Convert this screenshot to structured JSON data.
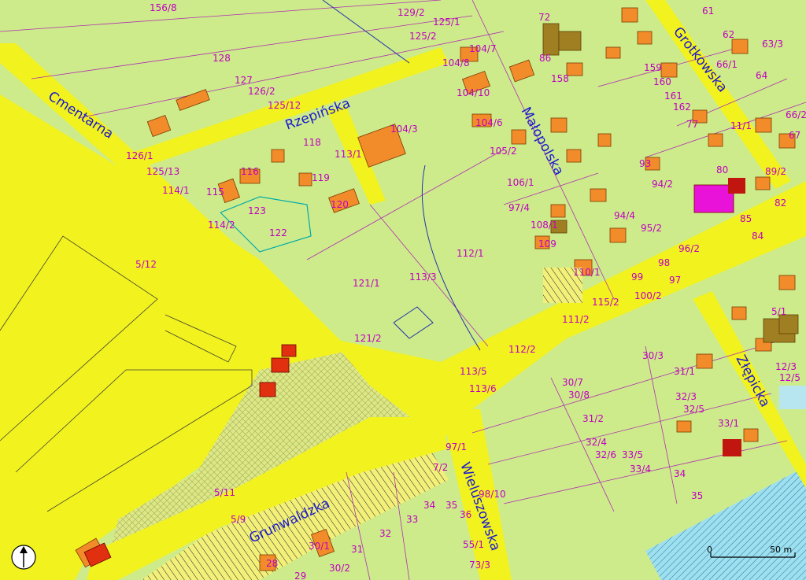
{
  "streets": {
    "cmentarna": "Cmentarna",
    "rzepinska": "Rzepińska",
    "grotkowska": "Grotkowska",
    "malopolska": "Małopolska",
    "zlepicka": "Złępicka",
    "grunwaldzka": "Grunwaldzka",
    "wieluszowska": "Wieluszowska"
  },
  "parcels": {
    "p156_8": "156/8",
    "p129_2": "129/2",
    "p125_1": "125/1",
    "p125_2": "125/2",
    "p128": "128",
    "p127": "127",
    "p126_2": "126/2",
    "p125_12": "125/12",
    "p126_1": "126/1",
    "p125_13": "125/13",
    "p118": "118",
    "p113_1": "113/1",
    "p116": "116",
    "p115": "115",
    "p119": "119",
    "p120": "120",
    "p123": "123",
    "p114_2": "114/2",
    "p122": "122",
    "p114_1": "114/1",
    "p5_12": "5/12",
    "p121_1": "121/1",
    "p113_3": "113/3",
    "p112_1": "112/1",
    "p104_3": "104/3",
    "p104_8": "104/8",
    "p104_10": "104/10",
    "p104_6": "104/6",
    "p104_7": "104/7",
    "p105_2": "105/2",
    "p106_1": "106/1",
    "p97_4": "97/4",
    "p108_1": "108/1",
    "p109": "109",
    "p110_1": "110/1",
    "p72": "72",
    "p86": "86",
    "p158": "158",
    "p159": "159",
    "p160": "160",
    "p161": "161",
    "p162": "162",
    "p77": "77",
    "p61": "61",
    "p62": "62",
    "p63_3": "63/3",
    "p64": "64",
    "p66_2": "66/2",
    "p67": "67",
    "p80": "80",
    "p82": "82",
    "p85": "85",
    "p84": "84",
    "p94_2": "94/2",
    "p95_2": "95/2",
    "p94_4": "94/4",
    "p96_2": "96/2",
    "p98": "98",
    "p99": "99",
    "p97": "97",
    "p100_2": "100/2",
    "p115_2": "115/2",
    "p111_2": "111/2",
    "p112_2": "112/2",
    "p121_2": "121/2",
    "p113_5": "113/5",
    "p113_6": "113/6",
    "p30_3": "30/3",
    "p31_1": "31/1",
    "p30_7": "30/7",
    "p30_8": "30/8",
    "p32_3": "32/3",
    "p32_5": "32/5",
    "p31_2": "31/2",
    "p32_4": "32/4",
    "p32_6": "32/6",
    "p33_5": "33/5",
    "p33_4": "33/4",
    "p34": "34",
    "p35": "35",
    "p5_1": "5/1",
    "p12_3": "12/3",
    "p12_5": "12/5",
    "p33_1": "33/1",
    "p5_11": "5/11",
    "p5_9": "5/9",
    "p33": "33",
    "p32": "32",
    "p31": "31",
    "p30_1": "30/1",
    "p30_2": "30/2",
    "p29": "29",
    "p28": "28",
    "p34b": "34",
    "p35b": "35",
    "p36": "36",
    "p98_10": "98/10",
    "p7_2": "7/2",
    "p97_1": "97/1",
    "p55_1": "55/1",
    "p73_3": "73/3",
    "p11_1": "11/1",
    "p93": "93",
    "p89_2": "89/2",
    "p66_1": "66/1"
  },
  "scale": {
    "zero": "0",
    "fifty": "50 m"
  },
  "north_arrow": "north-arrow-icon"
}
